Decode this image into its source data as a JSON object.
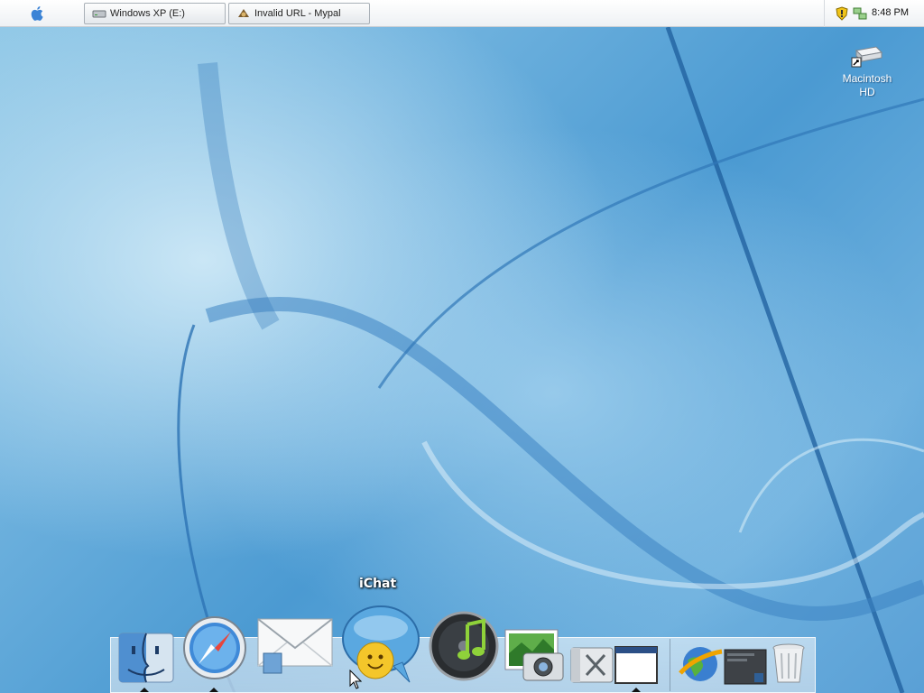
{
  "menubar": {
    "apple_icon": "apple-logo-icon",
    "taskbar_buttons": [
      {
        "label": "Windows XP (E:)",
        "icon": "drive-icon"
      },
      {
        "label": "Invalid URL - Mypal",
        "icon": "mypal-browser-icon"
      }
    ],
    "tray": {
      "icons": [
        "security-shield-icon",
        "network-icon"
      ],
      "clock": "8:48 PM"
    }
  },
  "desktop": {
    "icons": [
      {
        "label_line1": "Macintosh",
        "label_line2": "HD",
        "icon": "hard-drive-icon"
      }
    ]
  },
  "dock": {
    "tooltip": "iChat",
    "items": [
      {
        "name": "finder-icon",
        "running": true
      },
      {
        "name": "safari-icon",
        "running": true
      },
      {
        "name": "mail-icon",
        "running": false
      },
      {
        "name": "ichat-icon",
        "running": false
      },
      {
        "name": "itunes-icon",
        "running": false
      },
      {
        "name": "iphoto-icon",
        "running": false
      },
      {
        "name": "system-preferences-icon",
        "running": false
      },
      {
        "name": "window-icon",
        "running": true
      },
      {
        "name": "internet-globe-icon",
        "running": false
      },
      {
        "name": "desktop-icon",
        "running": false
      },
      {
        "name": "trash-icon",
        "running": false
      }
    ]
  },
  "colors": {
    "wallpaper": "#5aa3d8",
    "menubar": "#f3f5f7",
    "dock_indicator": "#111111"
  }
}
